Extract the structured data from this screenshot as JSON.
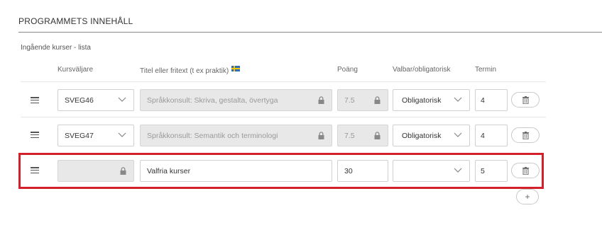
{
  "section": {
    "title": "PROGRAMMETS INNEHÅLL",
    "list_label": "Ingående kurser - lista"
  },
  "columns": {
    "course_selector": "Kursväljare",
    "title": "Titel eller fritext (t ex praktik)",
    "title_flag": "swedish-flag-icon",
    "points": "Poäng",
    "mandatory": "Valbar/obligatorisk",
    "term": "Termin"
  },
  "rows": [
    {
      "course_code": "SVEG46",
      "title": "Språkkonsult: Skriva, gestalta, övertyga",
      "points": "7.5",
      "mandatory": "Obligatorisk",
      "term": "4"
    },
    {
      "course_code": "SVEG47",
      "title": "Språkkonsult: Semantik och terminologi",
      "points": "7.5",
      "mandatory": "Obligatorisk",
      "term": "4"
    },
    {
      "course_code": "",
      "title": "Valfria kurser",
      "points": "30",
      "mandatory": "",
      "term": "5"
    }
  ],
  "add_label": "+",
  "colors": {
    "highlight": "#d3202a",
    "disabled_bg": "#e8e8e8"
  }
}
